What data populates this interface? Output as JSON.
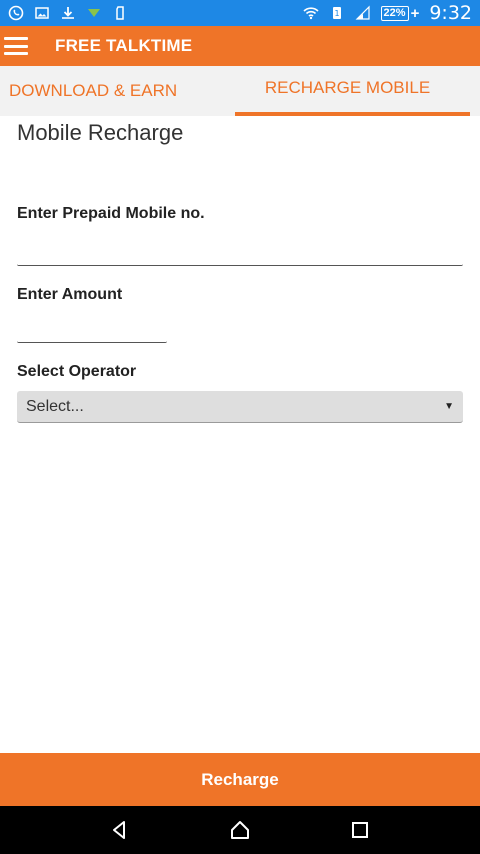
{
  "status_bar": {
    "battery": "22%",
    "battery_plus": "+",
    "time": "9:32"
  },
  "toolbar": {
    "title": "FREE TALKTIME"
  },
  "tabs": [
    {
      "label": "DOWNLOAD & EARN",
      "selected": false
    },
    {
      "label": "RECHARGE MOBILE",
      "selected": true
    }
  ],
  "form": {
    "title": "Mobile Recharge",
    "mobile_label": "Enter Prepaid Mobile no.",
    "mobile_value": "",
    "amount_label": "Enter Amount",
    "amount_value": "",
    "operator_label": "Select Operator",
    "operator_selected": "Select..."
  },
  "actions": {
    "recharge_label": "Recharge"
  },
  "colors": {
    "accent": "#ef7428",
    "status_bar": "#1e88e5"
  }
}
